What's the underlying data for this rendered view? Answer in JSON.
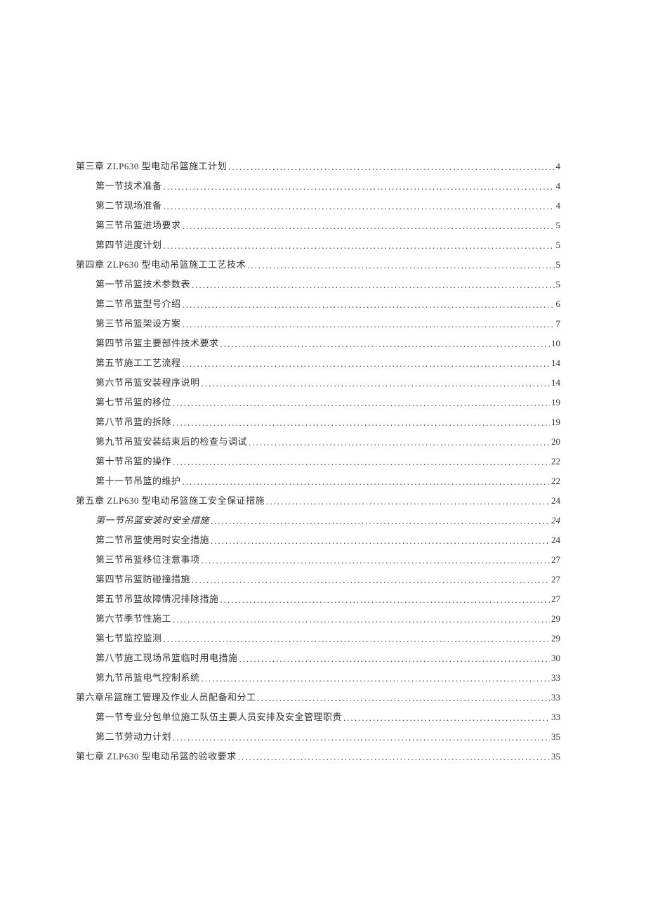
{
  "toc": [
    {
      "level": 1,
      "title": "第三章 ZLP630 型电动吊篮施工计划",
      "page": "4",
      "italic": false
    },
    {
      "level": 2,
      "title": "第一节技术准备",
      "page": "4",
      "italic": false
    },
    {
      "level": 2,
      "title": "第二节现场准备",
      "page": "4",
      "italic": false
    },
    {
      "level": 2,
      "title": "第三节吊篮进场要求",
      "page": "5",
      "italic": false
    },
    {
      "level": 2,
      "title": "第四节进度计划",
      "page": "5",
      "italic": false
    },
    {
      "level": 1,
      "title": "第四章 ZLP630 型电动吊篮施工工艺技术",
      "page": "5",
      "italic": false
    },
    {
      "level": 2,
      "title": "第一节吊篮技术参数表",
      "page": "5",
      "italic": false
    },
    {
      "level": 2,
      "title": "第二节吊篮型号介绍",
      "page": "6",
      "italic": false
    },
    {
      "level": 2,
      "title": "第三节吊篮架设方案",
      "page": "7",
      "italic": false
    },
    {
      "level": 2,
      "title": "第四节吊篮主要部件技术要求",
      "page": "10",
      "italic": false
    },
    {
      "level": 2,
      "title": "第五节施工工艺流程",
      "page": "14",
      "italic": false
    },
    {
      "level": 2,
      "title": "第六节吊篮安装程序说明",
      "page": "14",
      "italic": false
    },
    {
      "level": 2,
      "title": "第七节吊篮的移位",
      "page": "19",
      "italic": false
    },
    {
      "level": 2,
      "title": "第八节吊篮的拆除",
      "page": "19",
      "italic": false
    },
    {
      "level": 2,
      "title": "第九节吊篮安装结束后的检查与调试",
      "page": "20",
      "italic": false
    },
    {
      "level": 2,
      "title": "第十节吊篮的操作",
      "page": "22",
      "italic": false
    },
    {
      "level": 2,
      "title": "第十一节吊篮的维护",
      "page": "22",
      "italic": false
    },
    {
      "level": 1,
      "title": "第五章 ZLP630 型电动吊篮施工安全保证措施",
      "page": "24",
      "italic": false
    },
    {
      "level": 2,
      "title": "第一节吊篮安装时安全措施",
      "page": "24",
      "italic": true
    },
    {
      "level": 2,
      "title": "第二节吊篮使用时安全措施",
      "page": "24",
      "italic": false
    },
    {
      "level": 2,
      "title": "第三节吊篮移位注意事项",
      "page": "27",
      "italic": false
    },
    {
      "level": 2,
      "title": "第四节吊篮防碰撞措施",
      "page": "27",
      "italic": false
    },
    {
      "level": 2,
      "title": "第五节吊篮故障情况排除措施",
      "page": "27",
      "italic": false
    },
    {
      "level": 2,
      "title": "第六节季节性施工",
      "page": "29",
      "italic": false
    },
    {
      "level": 2,
      "title": "第七节监控监测",
      "page": "29",
      "italic": false
    },
    {
      "level": 2,
      "title": "第八节施工现场吊篮临时用电措施",
      "page": "30",
      "italic": false
    },
    {
      "level": 2,
      "title": "第九节吊篮电气控制系统",
      "page": "33",
      "italic": false
    },
    {
      "level": 1,
      "title": "第六章吊篮施工管理及作业人员配备和分工",
      "page": "33",
      "italic": false
    },
    {
      "level": 2,
      "title": "第一节专业分包单位施工队伍主要人员安排及安全管理职责",
      "page": "33",
      "italic": false
    },
    {
      "level": 2,
      "title": "第二节劳动力计划",
      "page": "35",
      "italic": false
    },
    {
      "level": 1,
      "title": "第七章 ZLP630 型电动吊篮的验收要求",
      "page": "35",
      "italic": false
    }
  ]
}
